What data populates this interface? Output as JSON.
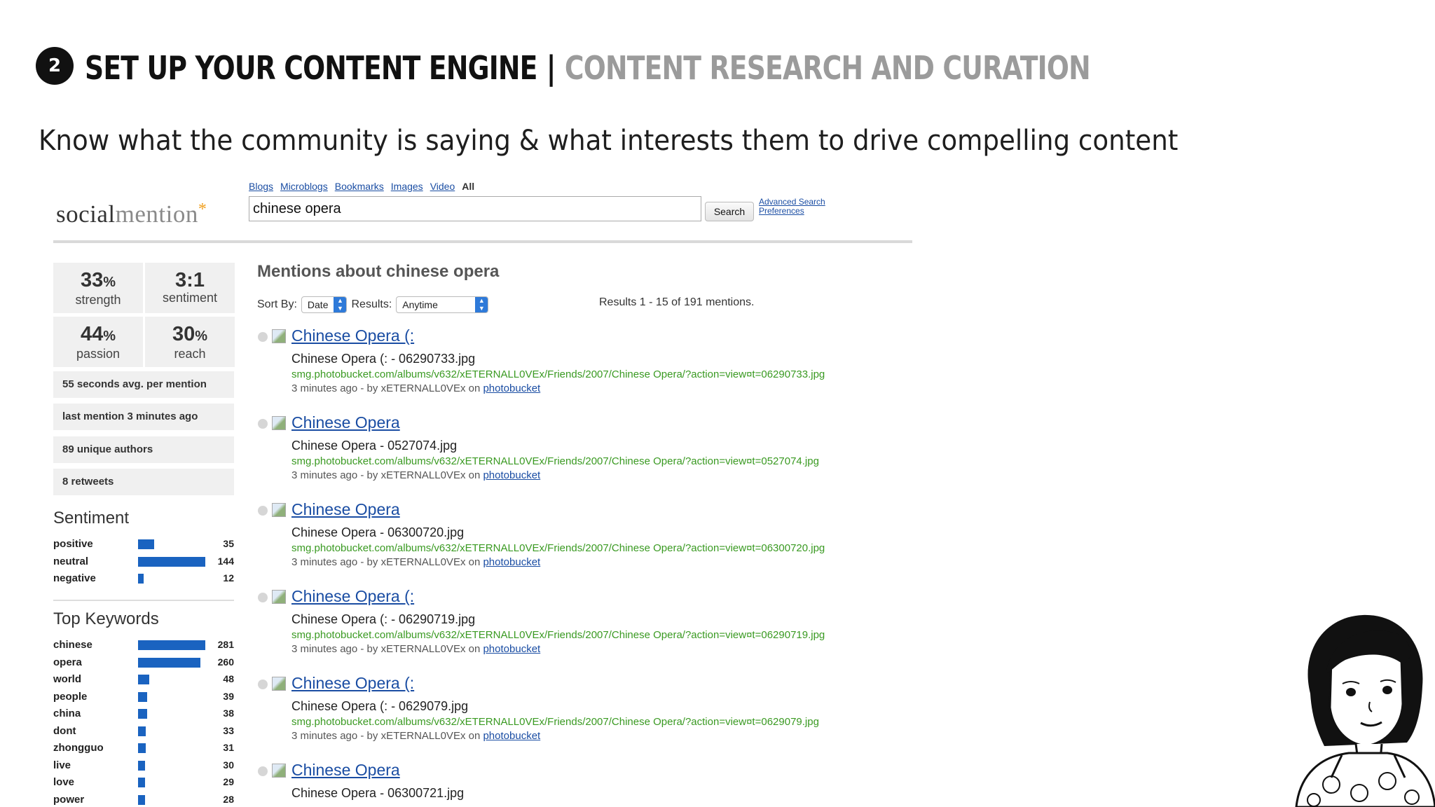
{
  "slide": {
    "step": "2",
    "title_main": "SET UP YOUR CONTENT ENGINE",
    "title_sep": "|",
    "title_sub": "CONTENT RESEARCH AND CURATION",
    "subtitle": "Know what the community is saying & what interests them to drive compelling content"
  },
  "app": {
    "logo_a": "social",
    "logo_b": "mention",
    "logo_star": "*",
    "tabs": [
      "Blogs",
      "Microblogs",
      "Bookmarks",
      "Images",
      "Video",
      "All"
    ],
    "active_tab": "All",
    "search_value": "chinese opera",
    "search_button": "Search",
    "advanced_search": "Advanced Search",
    "preferences": "Preferences"
  },
  "stats": {
    "strength_value": "33",
    "strength_unit": "%",
    "strength_label": "strength",
    "sentiment_value": "3:1",
    "sentiment_label": "sentiment",
    "passion_value": "44",
    "passion_unit": "%",
    "passion_label": "passion",
    "reach_value": "30",
    "reach_unit": "%",
    "reach_label": "reach",
    "avg_per_mention": "55 seconds avg. per mention",
    "last_mention": "last mention 3 minutes ago",
    "unique_authors": "89 unique authors",
    "retweets": "8 retweets"
  },
  "sentiment": {
    "heading": "Sentiment",
    "rows": [
      {
        "label": "positive",
        "value": 35
      },
      {
        "label": "neutral",
        "value": 144
      },
      {
        "label": "negative",
        "value": 12
      }
    ]
  },
  "keywords": {
    "heading": "Top Keywords",
    "rows": [
      {
        "label": "chinese",
        "value": 281
      },
      {
        "label": "opera",
        "value": 260
      },
      {
        "label": "world",
        "value": 48
      },
      {
        "label": "people",
        "value": 39
      },
      {
        "label": "china",
        "value": 38
      },
      {
        "label": "dont",
        "value": 33
      },
      {
        "label": "zhongguo",
        "value": 31
      },
      {
        "label": "live",
        "value": 30
      },
      {
        "label": "love",
        "value": 29
      },
      {
        "label": "power",
        "value": 28
      }
    ]
  },
  "results": {
    "heading": "Mentions about chinese opera",
    "sort_by_label": "Sort By:",
    "sort_by_value": "Date",
    "results_label": "Results:",
    "results_value": "Anytime",
    "count_text": "Results 1 - 15 of 191 mentions.",
    "items": [
      {
        "title": "Chinese Opera (:",
        "desc": "Chinese Opera (: - 06290733.jpg",
        "url": "smg.photobucket.com/albums/v632/xETERNALL0VEx/Friends/2007/Chinese Opera/?action=view¤t=06290733.jpg",
        "meta": "3 minutes ago - by xETERNALL0VEx on",
        "source": "photobucket"
      },
      {
        "title": "Chinese Opera",
        "desc": "Chinese Opera - 0527074.jpg",
        "url": "smg.photobucket.com/albums/v632/xETERNALL0VEx/Friends/2007/Chinese Opera/?action=view¤t=0527074.jpg",
        "meta": "3 minutes ago - by xETERNALL0VEx on",
        "source": "photobucket"
      },
      {
        "title": "Chinese Opera",
        "desc": "Chinese Opera - 06300720.jpg",
        "url": "smg.photobucket.com/albums/v632/xETERNALL0VEx/Friends/2007/Chinese Opera/?action=view¤t=06300720.jpg",
        "meta": "3 minutes ago - by xETERNALL0VEx on",
        "source": "photobucket"
      },
      {
        "title": "Chinese Opera (:",
        "desc": "Chinese Opera (: - 06290719.jpg",
        "url": "smg.photobucket.com/albums/v632/xETERNALL0VEx/Friends/2007/Chinese Opera/?action=view¤t=06290719.jpg",
        "meta": "3 minutes ago - by xETERNALL0VEx on",
        "source": "photobucket"
      },
      {
        "title": "Chinese Opera (:",
        "desc": "Chinese Opera (: - 0629079.jpg",
        "url": "smg.photobucket.com/albums/v632/xETERNALL0VEx/Friends/2007/Chinese Opera/?action=view¤t=0629079.jpg",
        "meta": "3 minutes ago - by xETERNALL0VEx on",
        "source": "photobucket"
      },
      {
        "title": "Chinese Opera",
        "desc": "Chinese Opera - 06300721.jpg",
        "url": "",
        "meta": "",
        "source": ""
      }
    ]
  }
}
